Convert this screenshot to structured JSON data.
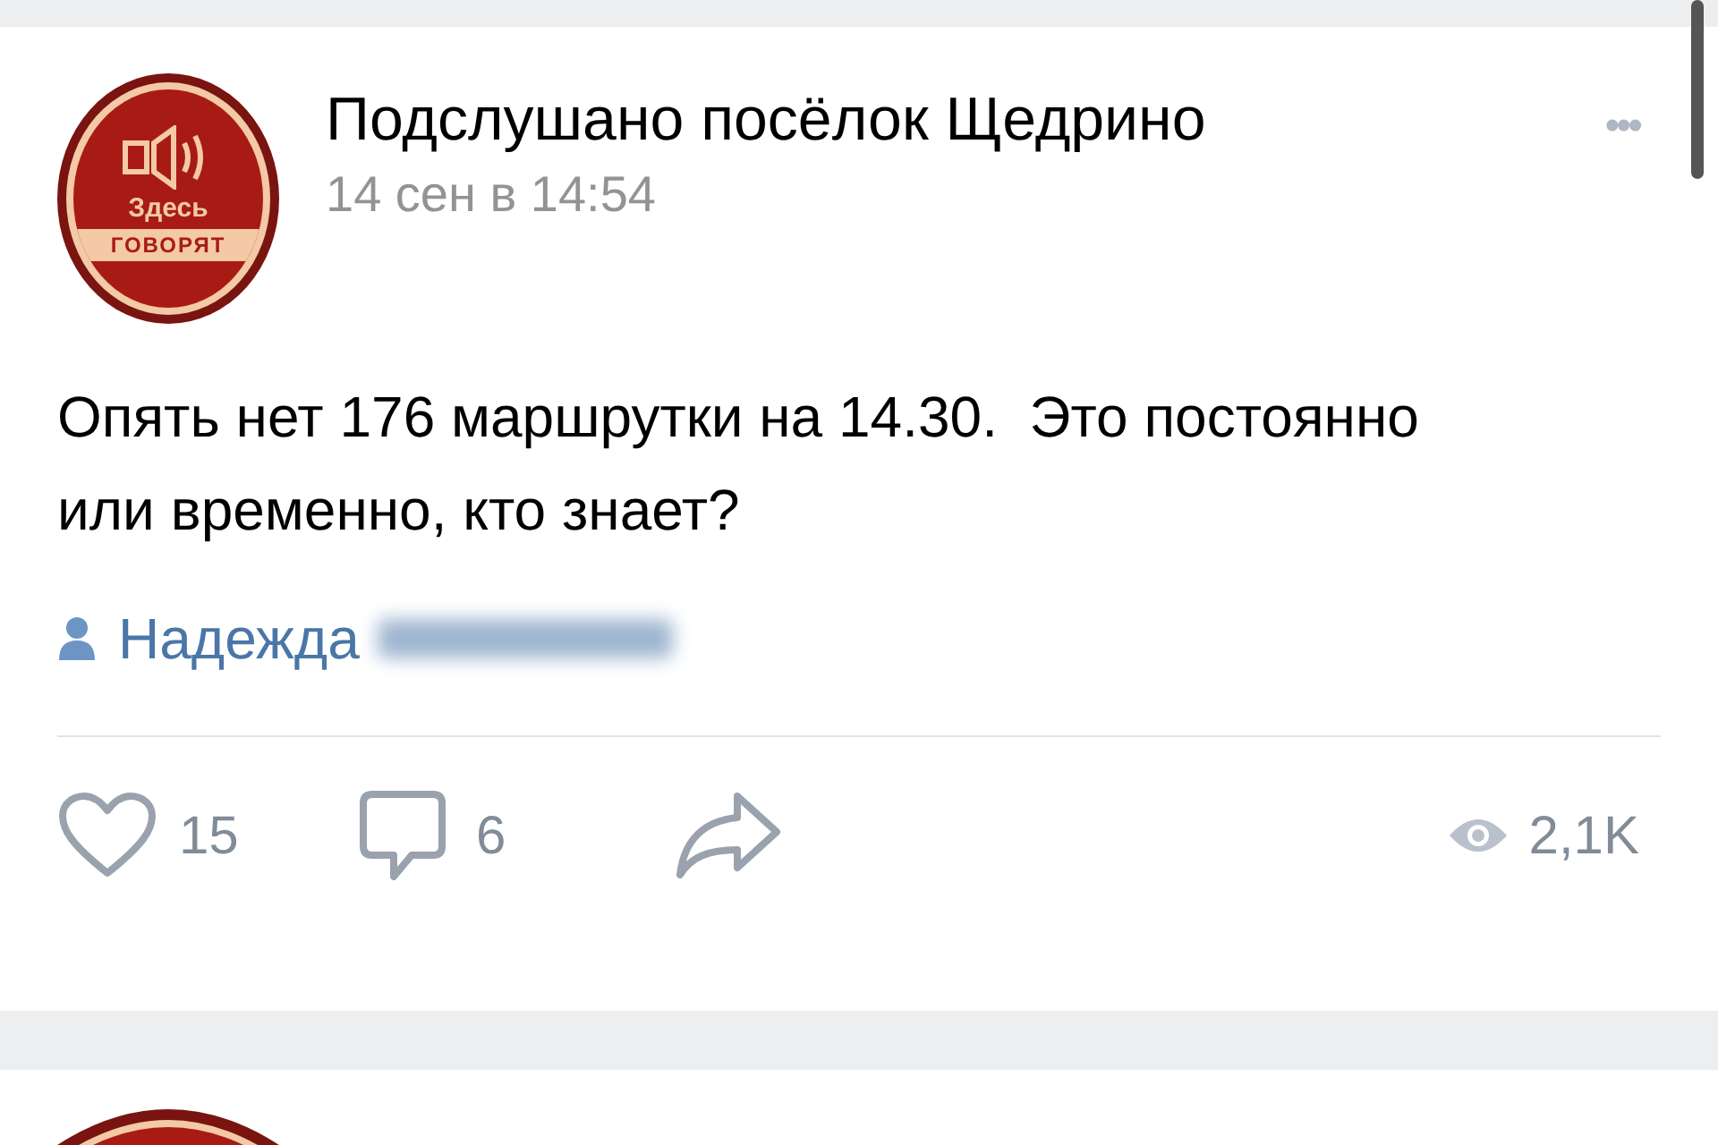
{
  "post": {
    "avatar": {
      "line_1": "Здесь",
      "line_2": "ГОВОРЯТ"
    },
    "author": "Подслушано посёлок Щедрино",
    "date": "14 сен в 14:54",
    "menu": "•••",
    "text": "Опять нет 176 маршрутки на 14.30.  Это постоянно или временно, кто знает?",
    "signer": "Надежда",
    "likes": "15",
    "comments": "6",
    "views": "2,1K"
  }
}
